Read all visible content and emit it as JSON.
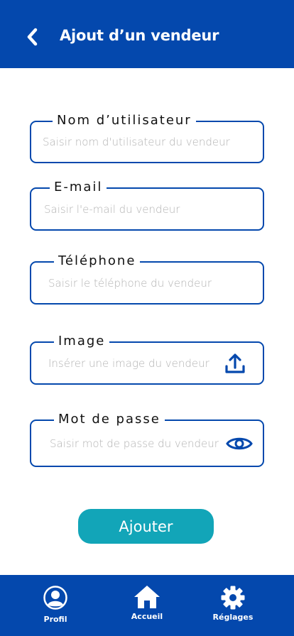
{
  "header": {
    "title": "Ajout d’un vendeur",
    "back_icon": "chevron-left-icon"
  },
  "form": {
    "username": {
      "label": "Nom d’utilisateur",
      "placeholder": "Saisir nom d'utilisateur du vendeur",
      "value": ""
    },
    "email": {
      "label": "E-mail",
      "placeholder": "Saisir l'e-mail du vendeur",
      "value": ""
    },
    "phone": {
      "label": "Téléphone",
      "placeholder": "Saisir le téléphone du vendeur",
      "value": ""
    },
    "image": {
      "label": "Image",
      "placeholder": "Insérer une image du vendeur",
      "value": "",
      "icon": "upload-icon"
    },
    "password": {
      "label": "Mot de passe",
      "placeholder": "Saisir mot de passe du vendeur",
      "value": "",
      "icon": "eye-icon"
    },
    "submit_label": "Ajouter"
  },
  "bottom_nav": {
    "items": [
      {
        "label": "Profil",
        "icon": "user-circle-icon"
      },
      {
        "label": "Accueil",
        "icon": "home-icon"
      },
      {
        "label": "Réglages",
        "icon": "gear-icon"
      }
    ]
  },
  "colors": {
    "primary": "#0448ad",
    "accent": "#12a5b8",
    "background": "#ffffff",
    "placeholder": "#b3b3b3"
  }
}
